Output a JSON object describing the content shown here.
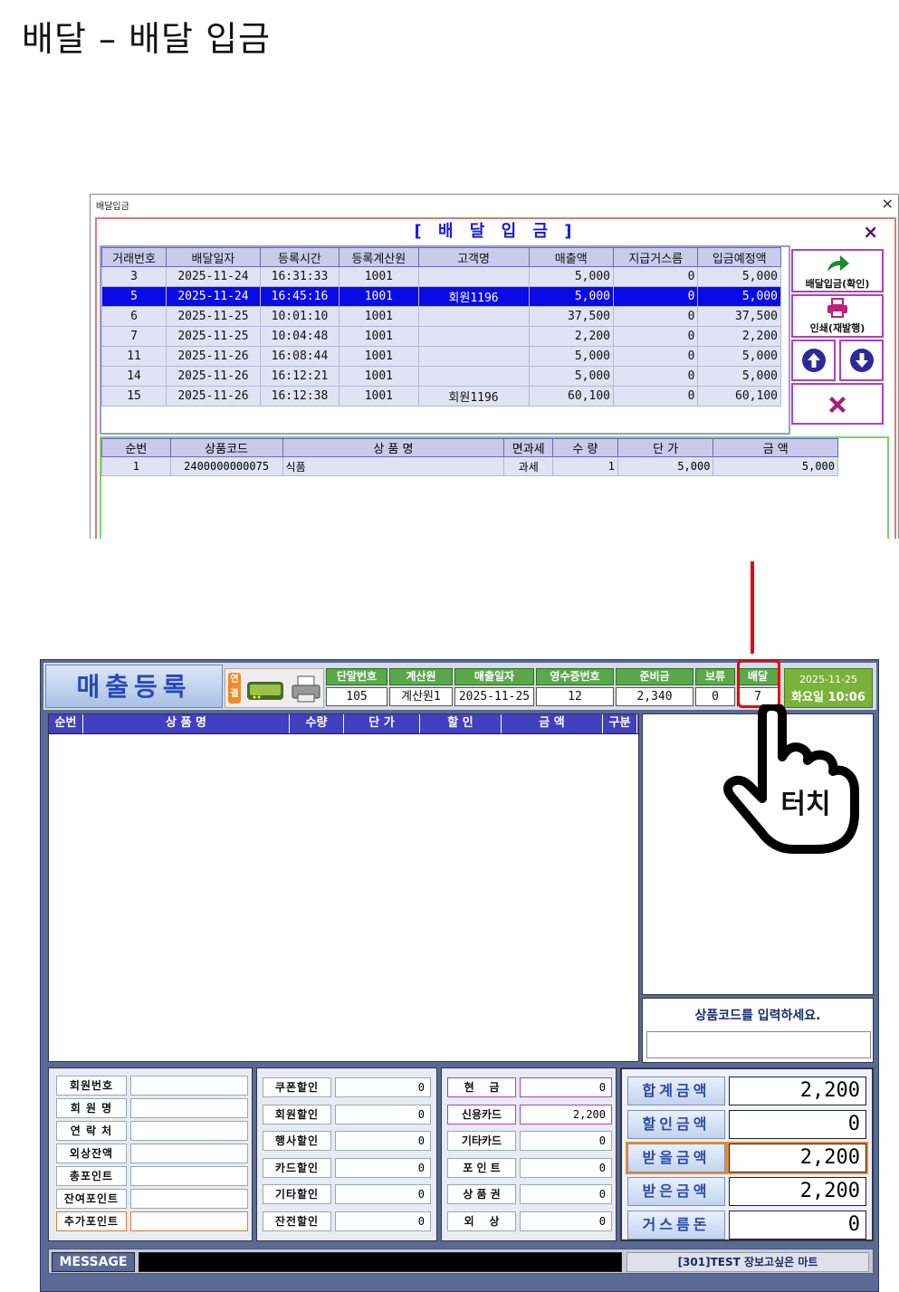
{
  "doc_title": "배달 – 배달 입금",
  "delivery_window": {
    "window_title": "배달입금",
    "close_glyph": "×",
    "header": "[ 배 달 입 금 ]",
    "header_close": "×",
    "columns": [
      "거래번호",
      "배달일자",
      "등록시간",
      "등록계산원",
      "고객명",
      "매출액",
      "지급거스름",
      "입금예정액"
    ],
    "rows": [
      [
        "3",
        "2025-11-24",
        "16:31:33",
        "1001",
        "",
        "5,000",
        "0",
        "5,000"
      ],
      [
        "5",
        "2025-11-24",
        "16:45:16",
        "1001",
        "회원1196",
        "5,000",
        "0",
        "5,000"
      ],
      [
        "6",
        "2025-11-25",
        "10:01:10",
        "1001",
        "",
        "37,500",
        "0",
        "37,500"
      ],
      [
        "7",
        "2025-11-25",
        "10:04:48",
        "1001",
        "",
        "2,200",
        "0",
        "2,200"
      ],
      [
        "11",
        "2025-11-26",
        "16:08:44",
        "1001",
        "",
        "5,000",
        "0",
        "5,000"
      ],
      [
        "14",
        "2025-11-26",
        "16:12:21",
        "1001",
        "",
        "5,000",
        "0",
        "5,000"
      ],
      [
        "15",
        "2025-11-26",
        "16:12:38",
        "1001",
        "회원1196",
        "60,100",
        "0",
        "60,100"
      ]
    ],
    "selected_row": 1,
    "btn_confirm": "배달입금(확인)",
    "btn_print": "인쇄(재발행)",
    "detail_columns": [
      "순번",
      "상품코드",
      "상 품 명",
      "면과세",
      "수 량",
      "단 가",
      "금 액"
    ],
    "detail_rows": [
      [
        "1",
        "2400000000075",
        "식품",
        "과세",
        "1",
        "5,000",
        "5,000"
      ]
    ]
  },
  "pos": {
    "brand": "매출등록",
    "conn_label": "연결",
    "info": [
      {
        "h": "단말번호",
        "v": "105"
      },
      {
        "h": "계산원",
        "v": "계산원1"
      },
      {
        "h": "매출일자",
        "v": "2025-11-25"
      },
      {
        "h": "영수증번호",
        "v": "12"
      },
      {
        "h": "준비금",
        "v": "2,340"
      },
      {
        "h": "보류",
        "v": "0"
      },
      {
        "h": "배달",
        "v": "7"
      }
    ],
    "date": "2025-11-25",
    "daytime": "화요일  10:06",
    "grid_cols": [
      "순번",
      "상 품 명",
      "수량",
      "단 가",
      "할 인",
      "금 액",
      "구분"
    ],
    "prompt": "상품코드를 입력하세요.",
    "member_labels": [
      "회원번호",
      "회 원 명",
      "연 락 처",
      "외상잔액",
      "총포인트",
      "잔여포인트",
      "추가포인트"
    ],
    "discount_labels": [
      "쿠폰할인",
      "회원할인",
      "행사할인",
      "카드할인",
      "기타할인",
      "잔전할인"
    ],
    "discount_values": [
      "0",
      "0",
      "0",
      "0",
      "0",
      "0"
    ],
    "pay_labels": [
      "현    금",
      "신용카드",
      "기타카드",
      "포 인 트",
      "상 품 권",
      "외    상"
    ],
    "pay_values": [
      "0",
      "2,200",
      "0",
      "0",
      "0",
      "0"
    ],
    "total_labels": [
      "합계금액",
      "할인금액",
      "받을금액",
      "받은금액",
      "거스름돈"
    ],
    "total_values": [
      "2,200",
      "0",
      "2,200",
      "2,200",
      "0"
    ],
    "message_label": "MESSAGE",
    "store": "[301]TEST 장보고싶은 마트"
  },
  "touch_label": "터치"
}
